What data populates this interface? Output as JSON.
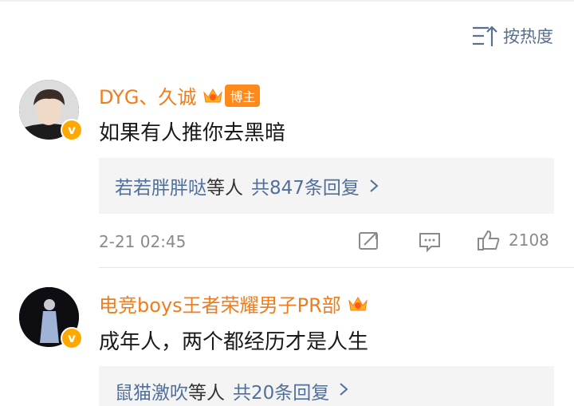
{
  "sort": {
    "label": "按热度"
  },
  "comments": [
    {
      "username": "DYG、久诚",
      "tag": "博主",
      "text": "如果有人推你去黑暗",
      "reply": {
        "names": "若若胖胖哒",
        "mid": "等人",
        "count": "共847条回复"
      },
      "time": "2-21 02:45",
      "likes": "2108"
    },
    {
      "username": "电竞boys王者荣耀男子PR部",
      "text": "成年人，两个都经历才是人生",
      "reply": {
        "names": "鼠猫激吹",
        "mid": "等人",
        "count": "共20条回复"
      }
    }
  ],
  "colors": {
    "accent": "#f07c1c",
    "link": "#50709a",
    "badge": "#ffa800"
  }
}
